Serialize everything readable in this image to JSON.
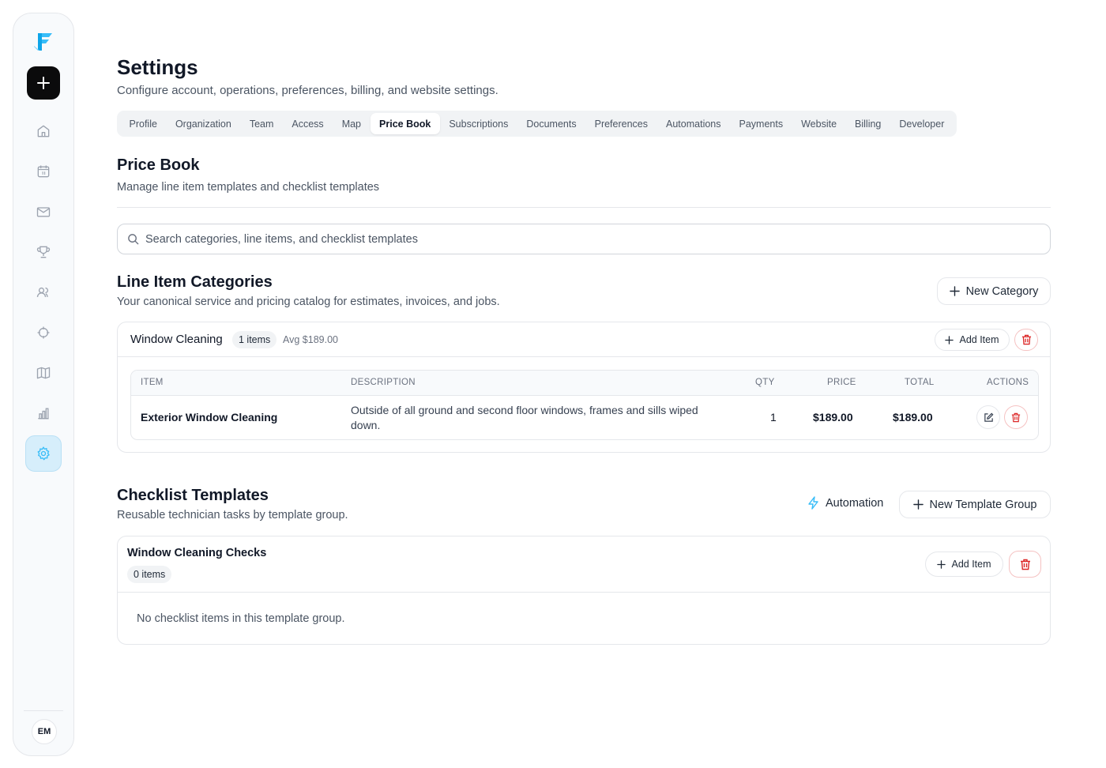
{
  "sidebar": {
    "add_icon": "plus-icon",
    "items": [
      {
        "name": "home",
        "icon": "home-icon"
      },
      {
        "name": "calendar",
        "icon": "calendar-icon"
      },
      {
        "name": "mail",
        "icon": "mail-icon"
      },
      {
        "name": "trophy",
        "icon": "trophy-icon"
      },
      {
        "name": "users",
        "icon": "users-icon"
      },
      {
        "name": "target",
        "icon": "crosshair-icon"
      },
      {
        "name": "map",
        "icon": "map-icon"
      },
      {
        "name": "reports",
        "icon": "bar-chart-icon"
      },
      {
        "name": "settings",
        "icon": "gear-icon",
        "active": true
      }
    ],
    "avatar_initials": "EM"
  },
  "header": {
    "title": "Settings",
    "subtitle": "Configure account, operations, preferences, billing, and website settings."
  },
  "tabs": [
    {
      "label": "Profile"
    },
    {
      "label": "Organization"
    },
    {
      "label": "Team"
    },
    {
      "label": "Access"
    },
    {
      "label": "Map"
    },
    {
      "label": "Price Book",
      "active": true
    },
    {
      "label": "Subscriptions"
    },
    {
      "label": "Documents"
    },
    {
      "label": "Preferences"
    },
    {
      "label": "Automations"
    },
    {
      "label": "Payments"
    },
    {
      "label": "Website"
    },
    {
      "label": "Billing"
    },
    {
      "label": "Developer"
    }
  ],
  "price_book": {
    "title": "Price Book",
    "subtitle": "Manage line item templates and checklist templates"
  },
  "search": {
    "placeholder": "Search categories, line items, and checklist templates",
    "value": ""
  },
  "line_item_categories": {
    "title": "Line Item Categories",
    "subtitle": "Your canonical service and pricing catalog for estimates, invoices, and jobs.",
    "new_category_label": "New Category",
    "categories": [
      {
        "name": "Window Cleaning",
        "count_label": "1 items",
        "avg_label": "Avg $189.00",
        "add_item_label": "Add Item",
        "columns": {
          "item": "ITEM",
          "description": "DESCRIPTION",
          "qty": "QTY",
          "price": "PRICE",
          "total": "TOTAL",
          "actions": "ACTIONS"
        },
        "rows": [
          {
            "item": "Exterior Window Cleaning",
            "description": "Outside of all ground and second floor windows, frames and sills wiped down.",
            "qty": "1",
            "price": "$189.00",
            "total": "$189.00"
          }
        ]
      }
    ]
  },
  "checklist_templates": {
    "title": "Checklist Templates",
    "subtitle": "Reusable technician tasks by template group.",
    "automation_label": "Automation",
    "new_group_label": "New Template Group",
    "groups": [
      {
        "name": "Window Cleaning Checks",
        "count_label": "0 items",
        "add_item_label": "Add Item",
        "empty_message": "No checklist items in this template group."
      }
    ]
  },
  "colors": {
    "accent": "#38bdf8",
    "danger": "#dc2626",
    "active_nav_bg": "#d6eefb"
  }
}
